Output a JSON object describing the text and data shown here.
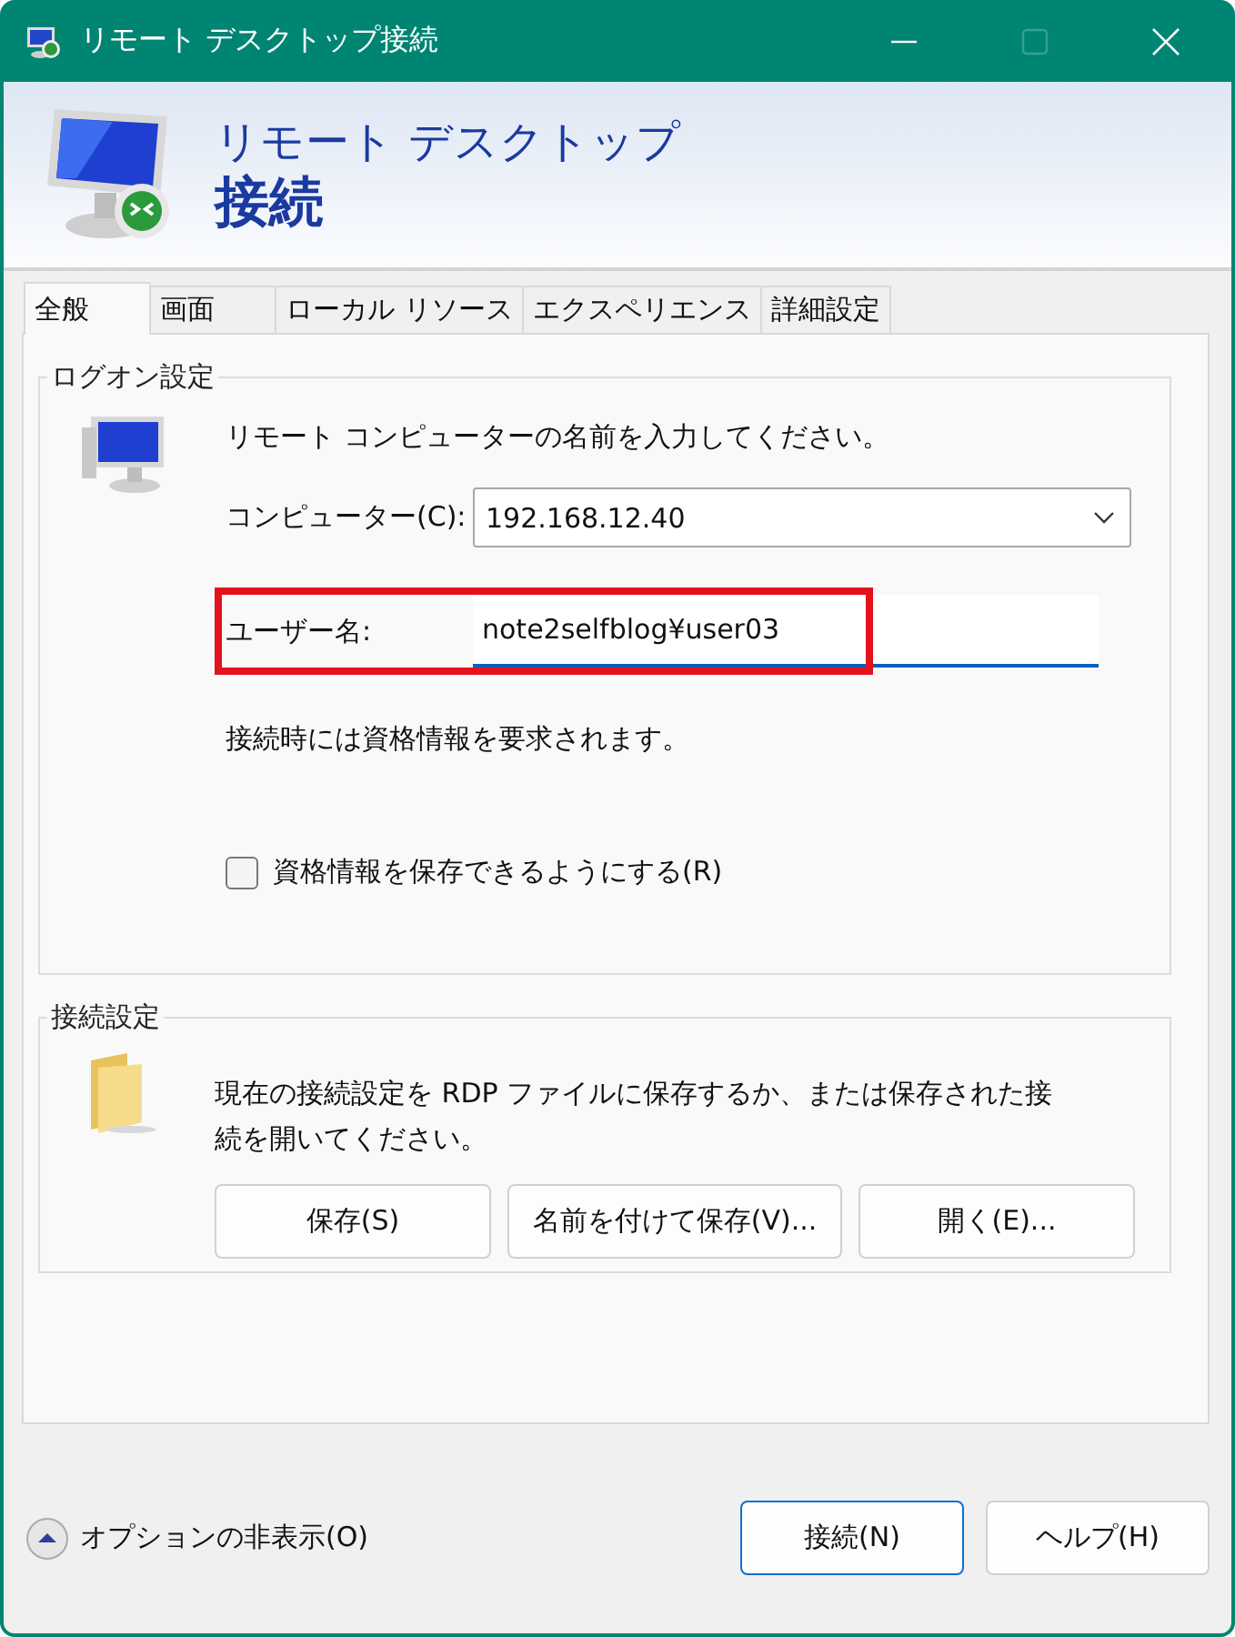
{
  "window": {
    "title": "リモート デスクトップ接続"
  },
  "header": {
    "line1": "リモート デスクトップ",
    "line2": "接続"
  },
  "tabs": [
    {
      "label": "全般",
      "selected": true
    },
    {
      "label": "画面",
      "selected": false
    },
    {
      "label": "ローカル リソース",
      "selected": false
    },
    {
      "label": "エクスペリエンス",
      "selected": false
    },
    {
      "label": "詳細設定",
      "selected": false
    }
  ],
  "logon": {
    "legend": "ログオン設定",
    "prompt": "リモート コンピューターの名前を入力してください。",
    "computer": {
      "label": "コンピューター(C):",
      "value": "192.168.12.40"
    },
    "username": {
      "label": "ユーザー名:",
      "value": "note2selfblog¥user03",
      "highlighted": true
    },
    "note": "接続時には資格情報を要求されます。",
    "save_credentials": {
      "label": "資格情報を保存できるようにする(R)",
      "checked": false
    }
  },
  "connection": {
    "legend": "接続設定",
    "description": "現在の接続設定を RDP ファイルに保存するか、または保存された接続を開いてください。",
    "buttons": [
      "保存(S)",
      "名前を付けて保存(V)...",
      "開く(E)..."
    ]
  },
  "footer": {
    "options_toggle": "オプションの非表示(O)",
    "buttons": [
      {
        "label": "接続(N)",
        "default": true
      },
      {
        "label": "ヘルプ(H)",
        "default": false
      }
    ]
  }
}
